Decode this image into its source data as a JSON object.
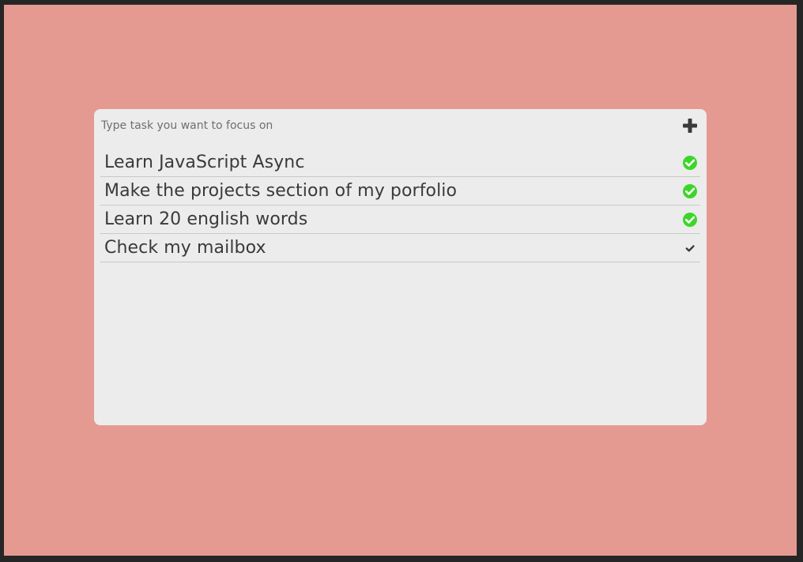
{
  "input": {
    "placeholder": "Type task you want to focus on",
    "value": ""
  },
  "add_button": {
    "icon": "plus-icon"
  },
  "colors": {
    "background": "#e59a91",
    "card": "#ececec",
    "done": "#3cd62a",
    "text": "#3a3a3a"
  },
  "tasks": [
    {
      "text": "Learn JavaScript Async",
      "done": true
    },
    {
      "text": "Make the projects section of my porfolio",
      "done": true
    },
    {
      "text": "Learn 20 english words",
      "done": true
    },
    {
      "text": "Check my mailbox",
      "done": false
    }
  ]
}
